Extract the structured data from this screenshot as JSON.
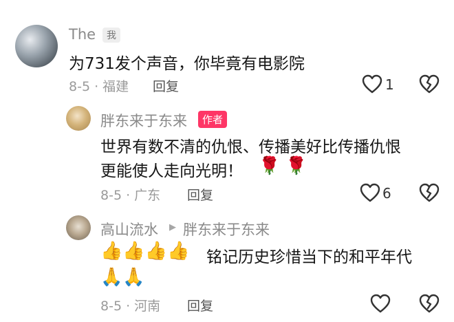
{
  "comments": [
    {
      "user": "The",
      "tag": "我",
      "text": "为731发个声音，你毕竟有电影院",
      "date_location": "8-5 · 福建",
      "reply_label": "回复",
      "like_count": "1"
    },
    {
      "user": "胖东来于东来",
      "tag": "作者",
      "text_line1": "世界有数不清的仇恨、传播美好比传播仇恨",
      "text_line2": "更能使人走向光明！",
      "emoji": "🌹 🌹",
      "date_location": "8-5 · 广东",
      "reply_label": "回复",
      "like_count": "6"
    },
    {
      "user": "高山流水",
      "reply_to": "胖东来于东来",
      "emoji_line1": "👍👍👍👍",
      "text": "铭记历史珍惜当下的和平年代",
      "emoji_line2": "🙏🙏",
      "date_location": "8-5 · 河南",
      "reply_label": "回复"
    }
  ],
  "icons": {
    "like": "heart-outline-icon",
    "dislike": "broken-heart-icon",
    "reply_arrow": "triangle-right-icon"
  },
  "colors": {
    "author_tag": "#fe3666",
    "text": "#161616",
    "meta": "#9a9a9a"
  }
}
